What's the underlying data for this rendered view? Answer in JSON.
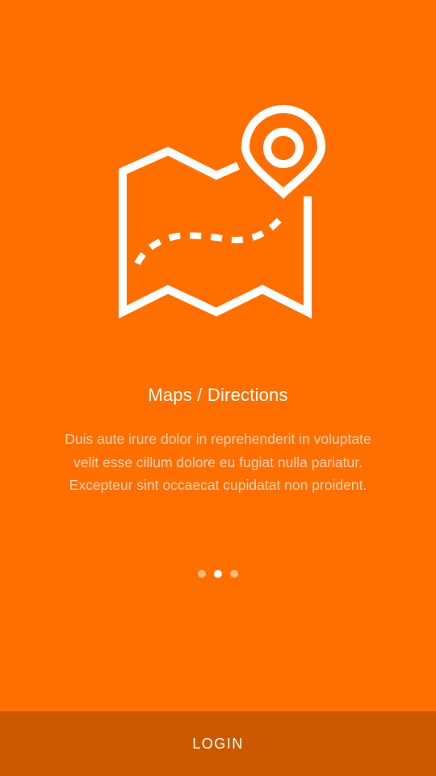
{
  "onboarding": {
    "illustration_icon": "map-pin-icon",
    "title": "Maps / Directions",
    "description": "Duis aute irure dolor in reprehenderit in voluptate velit esse cillum dolore eu fugiat nulla pariatur. Excepteur sint occaecat cupidatat non proident.",
    "page_total": 3,
    "page_current": 2
  },
  "footer": {
    "login_label": "LOGIN"
  },
  "colors": {
    "background": "#ff6f00",
    "footer_background": "#cc5900",
    "foreground": "#ffffff"
  }
}
